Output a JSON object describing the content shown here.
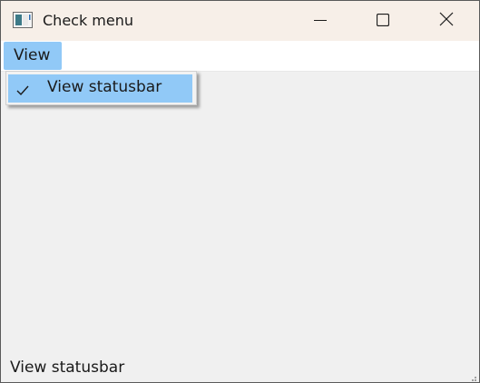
{
  "window": {
    "title": "Check menu",
    "icon": "app-window-icon",
    "controls": [
      "minimize-icon",
      "maximize-icon",
      "close-icon"
    ]
  },
  "menubar": {
    "items": [
      {
        "label": "View",
        "active": true
      }
    ]
  },
  "dropdown": {
    "items": [
      {
        "label": "View statusbar",
        "checked": true,
        "icon": "checkmark-icon"
      }
    ]
  },
  "statusbar": {
    "text": "View statusbar"
  },
  "colors": {
    "titlebar": "#f7efe8",
    "highlight": "#91c9f7",
    "client": "#f0f0f0",
    "menubar": "#ffffff"
  }
}
